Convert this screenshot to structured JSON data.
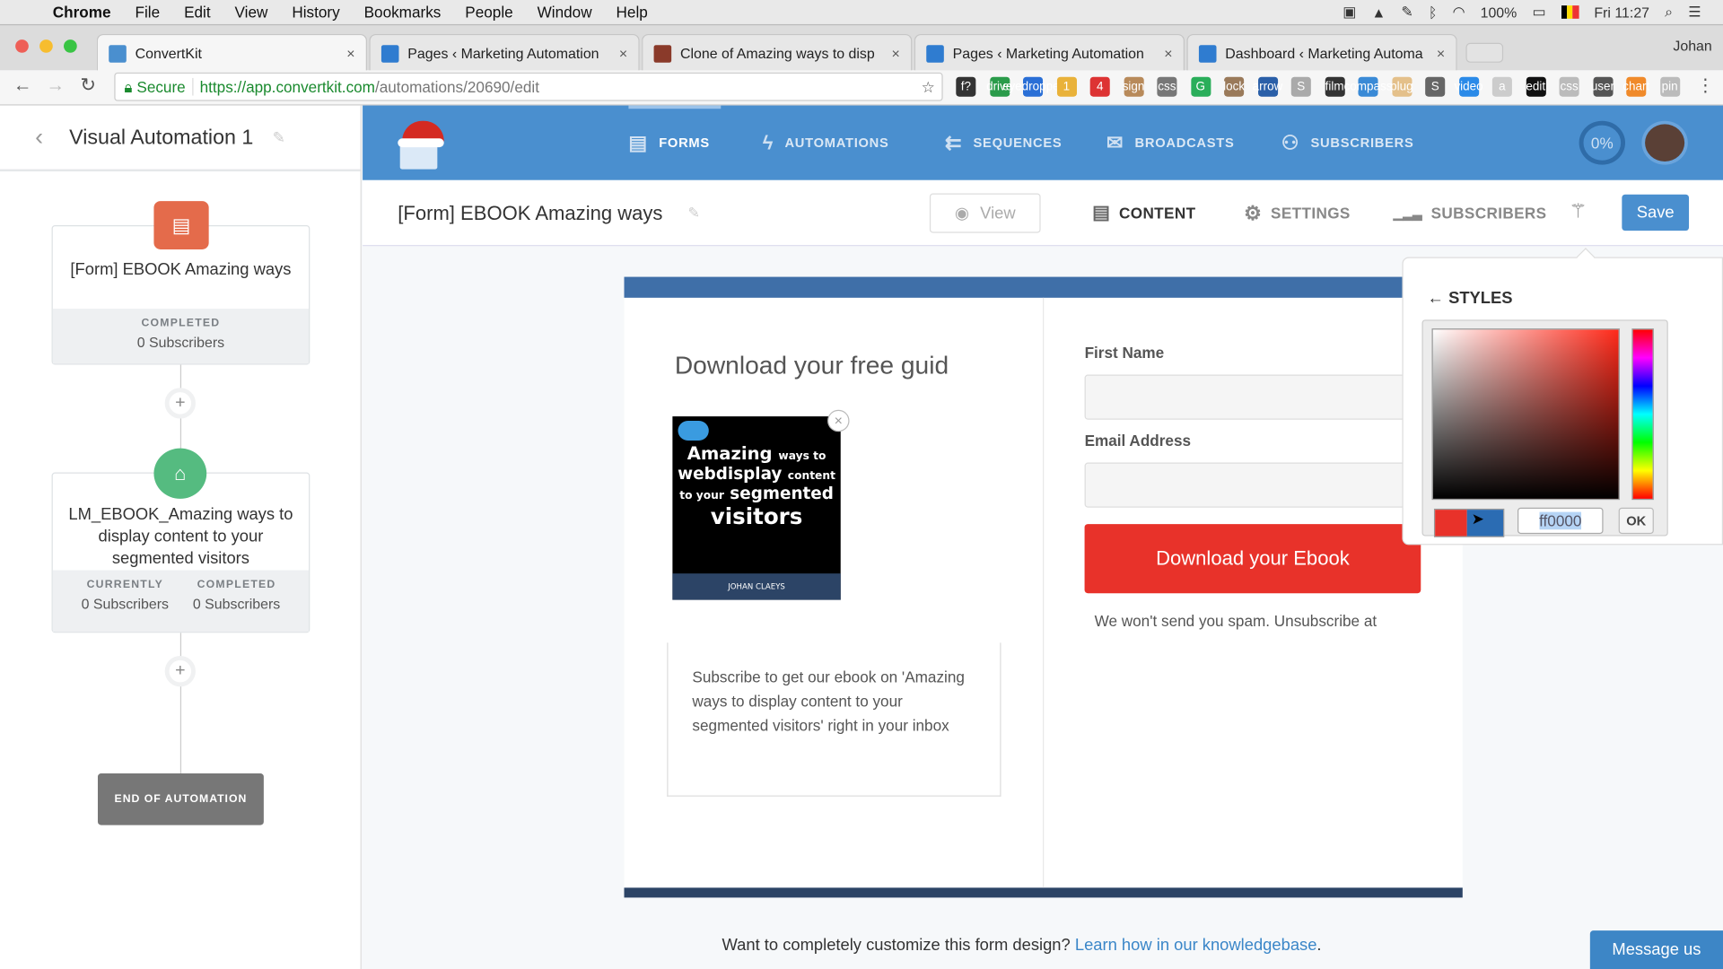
{
  "os_menubar": {
    "app": "Chrome",
    "menus": [
      "File",
      "Edit",
      "View",
      "History",
      "Bookmarks",
      "People",
      "Window",
      "Help"
    ],
    "battery": "100%",
    "clock": "Fri 11:27"
  },
  "browser": {
    "tabs": [
      {
        "title": "ConvertKit",
        "active": true
      },
      {
        "title": "Pages ‹ Marketing Automation",
        "active": false
      },
      {
        "title": "Clone of Amazing ways to disp",
        "active": false
      },
      {
        "title": "Pages ‹ Marketing Automation",
        "active": false
      },
      {
        "title": "Dashboard ‹ Marketing Automa",
        "active": false
      }
    ],
    "profile": "Johan",
    "secure_label": "Secure",
    "url_host": "https://app.convertkit.com",
    "url_path": "/automations/20690/edit",
    "extensions": [
      "f?",
      "drive",
      "eyedropper",
      "1",
      "4",
      "sign",
      "css",
      "G",
      "lock",
      "arrow",
      "S",
      "film",
      "compass",
      "plug",
      "S",
      "video",
      "a",
      "edit",
      "css",
      "user",
      "chart",
      "pin"
    ]
  },
  "sidebar": {
    "title": "Visual Automation 1",
    "nodes": [
      {
        "title": "[Form] EBOOK Amazing ways",
        "stats": [
          {
            "label": "COMPLETED",
            "value": "0 Subscribers"
          }
        ]
      },
      {
        "title": "LM_EBOOK_Amazing ways to display content to your segmented visitors",
        "stats": [
          {
            "label": "CURRENTLY",
            "value": "0 Subscribers"
          },
          {
            "label": "COMPLETED",
            "value": "0 Subscribers"
          }
        ]
      }
    ],
    "end_label": "END OF AUTOMATION"
  },
  "topnav": {
    "items": [
      "FORMS",
      "AUTOMATIONS",
      "SEQUENCES",
      "BROADCASTS",
      "SUBSCRIBERS"
    ],
    "active": "FORMS",
    "progress": "0%"
  },
  "subbar": {
    "form_title": "[Form] EBOOK Amazing ways",
    "view": "View",
    "tabs": [
      "CONTENT",
      "SETTINGS",
      "SUBSCRIBERS"
    ],
    "save": "Save"
  },
  "form": {
    "heading": "Download your free guid",
    "ebook": {
      "line1a": "Amazing",
      "line1b": "ways to",
      "line2a": "webdisplay",
      "line2b": "content",
      "line3a": "to your",
      "line3b": "segmented",
      "line4": "visitors",
      "author": "JOHAN CLAEYS"
    },
    "description": "Subscribe to get our ebook on 'Amazing ways to display content to your segmented visitors' right in your inbox",
    "first_name_label": "First Name",
    "email_label": "Email Address",
    "button": "Download your Ebook",
    "spam_note": "We won't send you spam. Unsubscribe at",
    "button_color": "#e8322a",
    "accent_color": "#3f6fa8"
  },
  "styles_panel": {
    "title": "← STYLES",
    "hex_value": "ff0000",
    "ok": "OK"
  },
  "footer": {
    "text": "Want to completely customize this form design?",
    "link": "Learn how in our knowledgebase",
    "period": "."
  },
  "chat": {
    "label": "Message us"
  }
}
